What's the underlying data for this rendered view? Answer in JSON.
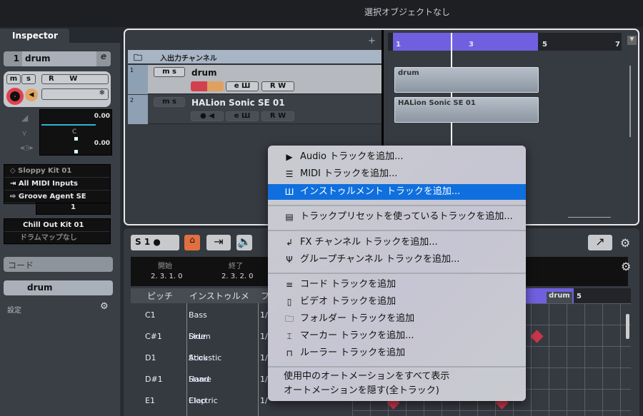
{
  "top_bar": {
    "status": "選択オブジェクトなし"
  },
  "inspector": {
    "tab": "Inspector",
    "track_number": "1",
    "track_name": "drum",
    "buttons": {
      "mute": "m",
      "solo": "s",
      "read": "R",
      "write": "W"
    },
    "volume": "0.00",
    "pan": "C",
    "delay": "0.00",
    "preset": "Sloppy Kit 01",
    "input": "All MIDI Inputs",
    "output": "Groove Agent SE",
    "channel": "1",
    "drum_kit": "Chill Out Kit 01",
    "drum_map": "ドラムマップなし",
    "chord_section": "コード",
    "instrument_section": "drum",
    "settings_label": "設定"
  },
  "project": {
    "add_button": "+",
    "folder": "入出力チャンネル",
    "tracks": [
      {
        "number": "1",
        "name": "drum",
        "selected": true
      },
      {
        "number": "2",
        "name": "HALion Sonic SE 01",
        "selected": false
      }
    ],
    "ruler": [
      "1",
      "3",
      "5",
      "7"
    ],
    "events": [
      "drum",
      "HALion Sonic SE 01"
    ],
    "loop_color": "#7060e0"
  },
  "editor": {
    "info_headers": {
      "start": "開始",
      "end": "終了"
    },
    "info_values": {
      "start": "2. 3. 1.  0",
      "end": "2. 3. 2.  0"
    },
    "columns": [
      "ピッチ",
      "インストゥルメ",
      "フ"
    ],
    "rows": [
      {
        "pitch": "C1",
        "instrument": "Bass Drum",
        "q": "1/"
      },
      {
        "pitch": "C#1",
        "instrument": "Side Stick",
        "q": "1/"
      },
      {
        "pitch": "D1",
        "instrument": "Acoustic Snare",
        "q": "1/"
      },
      {
        "pitch": "D#1",
        "instrument": "Hand Clap",
        "q": "1/"
      },
      {
        "pitch": "E1",
        "instrument": "Electric Snare",
        "q": "1/"
      }
    ],
    "ruler_label": "drum",
    "ruler_bar": "5",
    "toolbar": {
      "solo": "S",
      "one": "1"
    }
  },
  "context_menu": {
    "items": [
      {
        "icon": "audio-icon",
        "label": "Audio トラックを追加..."
      },
      {
        "icon": "midi-icon",
        "label": "MIDI トラックを追加..."
      },
      {
        "icon": "instrument-icon",
        "label": "インストゥルメント トラックを追加...",
        "highlighted": true
      },
      {
        "icon": "preset-icon",
        "label": "トラックプリセットを使っているトラックを追加..."
      },
      {
        "icon": "fx-icon",
        "label": "FX チャンネル トラックを追加..."
      },
      {
        "icon": "group-icon",
        "label": "グループチャンネル トラックを追加..."
      },
      {
        "icon": "chord-icon",
        "label": "コード トラックを追加"
      },
      {
        "icon": "video-icon",
        "label": "ビデオ トラックを追加"
      },
      {
        "icon": "folder-icon",
        "label": "フォルダー トラックを追加"
      },
      {
        "icon": "marker-icon",
        "label": "マーカー トラックを追加..."
      },
      {
        "icon": "ruler-icon",
        "label": "ルーラー トラックを追加"
      },
      {
        "label": "使用中のオートメーションをすべて表示"
      },
      {
        "label": "オートメーションを隠す(全トラック)"
      }
    ]
  }
}
